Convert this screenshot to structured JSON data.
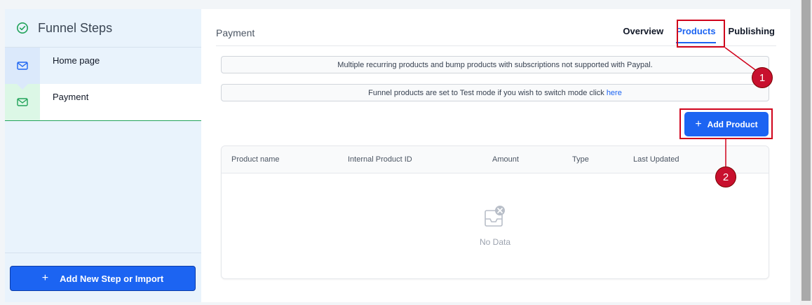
{
  "sidebar": {
    "title": "Funnel Steps",
    "steps": [
      {
        "label": "Home page"
      },
      {
        "label": "Payment"
      }
    ],
    "add_button_label": "Add New Step or Import"
  },
  "main": {
    "title": "Payment",
    "tabs": [
      {
        "label": "Overview"
      },
      {
        "label": "Products"
      },
      {
        "label": "Publishing"
      }
    ],
    "active_tab": "Products",
    "notice_paypal": "Multiple recurring products and bump products with subscriptions not supported with Paypal.",
    "notice_test_mode": "Funnel products are set to Test mode if you wish to switch mode click",
    "notice_test_mode_link": "here",
    "add_product_label": "Add Product",
    "table": {
      "columns": [
        "Product name",
        "Internal Product ID",
        "Amount",
        "Type",
        "Last Updated"
      ],
      "rows": [],
      "empty_text": "No Data"
    }
  },
  "annotations": [
    {
      "number": "1"
    },
    {
      "number": "2"
    }
  ],
  "colors": {
    "accent": "#1c64f2",
    "success": "#22a35a",
    "annotation": "#c8102e"
  }
}
